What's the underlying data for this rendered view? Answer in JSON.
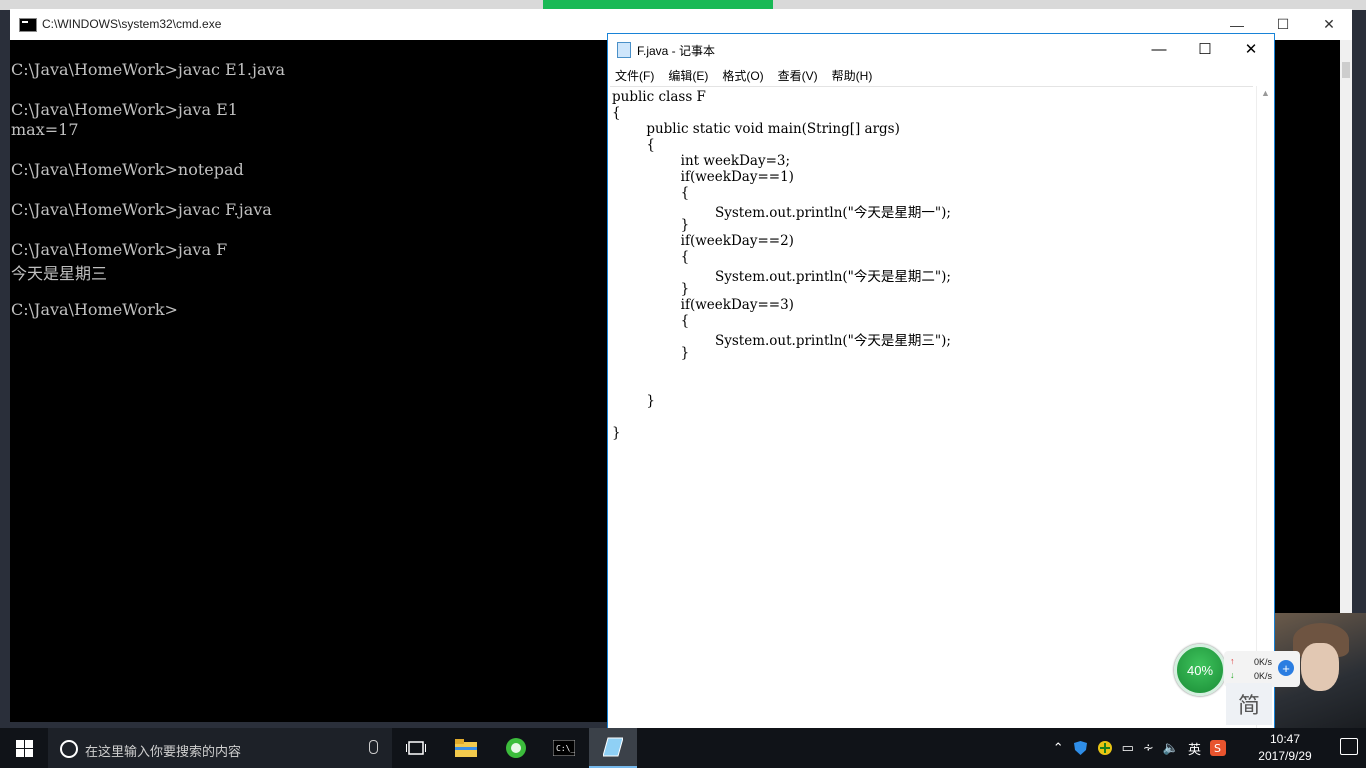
{
  "cmd": {
    "title": "C:\\WINDOWS\\system32\\cmd.exe",
    "lines": [
      "",
      "C:\\Java\\HomeWork>javac E1.java",
      "",
      "C:\\Java\\HomeWork>java E1",
      "max=17",
      "",
      "C:\\Java\\HomeWork>notepad",
      "",
      "C:\\Java\\HomeWork>javac F.java",
      "",
      "C:\\Java\\HomeWork>java F",
      "今天是星期三",
      "",
      "C:\\Java\\HomeWork>"
    ]
  },
  "notepad": {
    "title": "F.java - 记事本",
    "menu": [
      "文件(F)",
      "编辑(E)",
      "格式(O)",
      "查看(V)",
      "帮助(H)"
    ],
    "code": [
      "public class F",
      "{",
      "        public static void main(String[] args)",
      "        {",
      "                int weekDay=3;",
      "                if(weekDay==1)",
      "                {",
      "                        System.out.println(\"今天是星期一\");",
      "                }",
      "                if(weekDay==2)",
      "                {",
      "                        System.out.println(\"今天是星期二\");",
      "                }",
      "                if(weekDay==3)",
      "                {",
      "                        System.out.println(\"今天是星期三\");",
      "                }",
      "",
      "",
      "        }",
      "",
      "}"
    ]
  },
  "taskbar": {
    "search_placeholder": "在这里输入你要搜索的内容",
    "ime_label": "英",
    "time": "10:47",
    "date": "2017/9/29"
  },
  "widget": {
    "percent": "40%",
    "upload": "0K/s",
    "download": "0K/s",
    "ime_mode": "简"
  },
  "colors": {
    "accent": "#1883d7",
    "console_text": "#c0c0c0",
    "taskbar": "#101318"
  }
}
